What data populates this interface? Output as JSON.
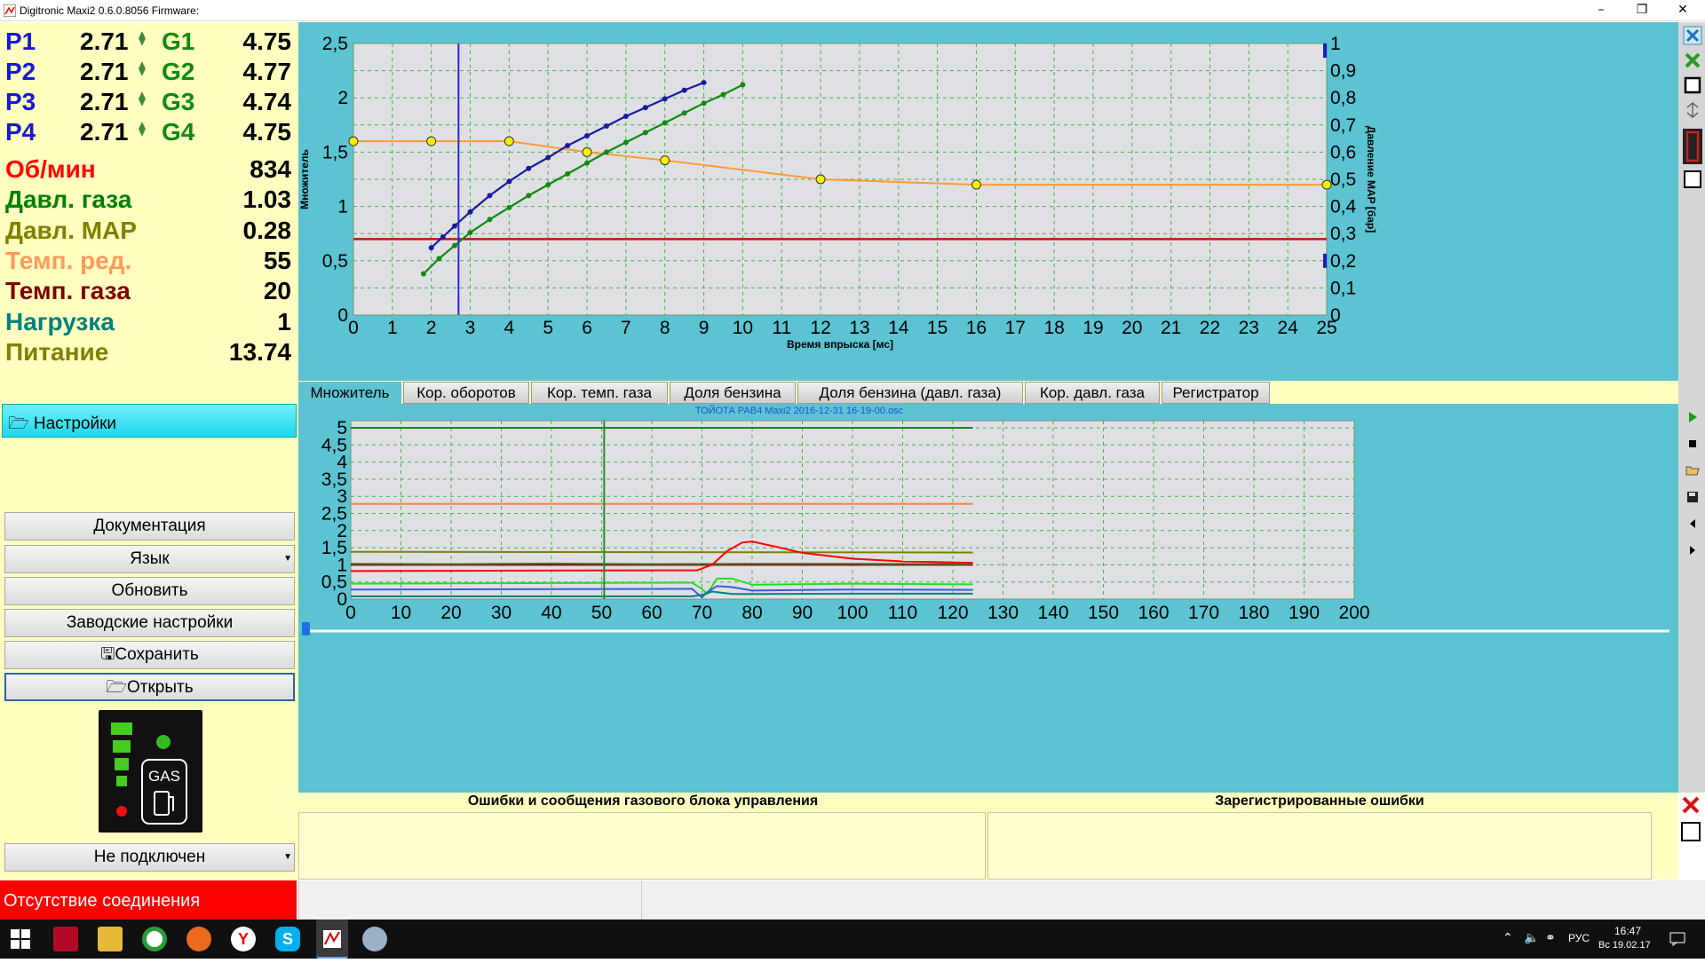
{
  "window": {
    "title": "Digitronic Maxi2 0.6.0.8056 Firmware:",
    "minimize": "–",
    "maximize": "❐",
    "close": "✕"
  },
  "injectors": [
    {
      "p_label": "P1",
      "p_value": "2.71",
      "g_label": "G1",
      "g_value": "4.75"
    },
    {
      "p_label": "P2",
      "p_value": "2.71",
      "g_label": "G2",
      "g_value": "4.77"
    },
    {
      "p_label": "P3",
      "p_value": "2.71",
      "g_label": "G3",
      "g_value": "4.74"
    },
    {
      "p_label": "P4",
      "p_value": "2.71",
      "g_label": "G4",
      "g_value": "4.75"
    }
  ],
  "params": [
    {
      "label": "Об/мин",
      "value": "834",
      "color": "#ff0000"
    },
    {
      "label": "Давл. газа",
      "value": "1.03",
      "color": "#008000"
    },
    {
      "label": "Давл. MAP",
      "value": "0.28",
      "color": "#808000"
    },
    {
      "label": "Темп. ред.",
      "value": "55",
      "color": "#ff9a5a"
    },
    {
      "label": "Темп. газа",
      "value": "20",
      "color": "#800000"
    },
    {
      "label": "Нагрузка",
      "value": "1",
      "color": "#008080"
    },
    {
      "label": "Питание",
      "value": "13.74",
      "color": "#808000"
    }
  ],
  "settings_label": "Настройки",
  "buttons": {
    "docs": "Документация",
    "language": "Язык",
    "update": "Обновить",
    "factory": "Заводские настройки",
    "save": "Сохранить",
    "open": "Открыть",
    "connection": "Не подключен"
  },
  "gas_indicator": {
    "label": "GAS"
  },
  "status": {
    "connection": "Отсутствие соединения"
  },
  "tabs": [
    "Множитель",
    "Кор. оборотов",
    "Кор. темп. газа",
    "Доля бензина",
    "Доля бензина (давл. газа)",
    "Кор. давл. газа",
    "Регистратор"
  ],
  "top_chart": {
    "ylabel": "Множитель",
    "y2label": "Давление MAP [бар]",
    "xlabel": "Время впрыска [мс]",
    "xlim": [
      0,
      25
    ],
    "ylim": [
      0,
      2.5
    ],
    "y2lim": [
      0,
      1
    ],
    "x_ticks": [
      "0",
      "1",
      "2",
      "3",
      "4",
      "5",
      "6",
      "7",
      "8",
      "9",
      "10",
      "11",
      "12",
      "13",
      "14",
      "15",
      "16",
      "17",
      "18",
      "19",
      "20",
      "21",
      "22",
      "23",
      "24",
      "25"
    ],
    "y_ticks": [
      "0",
      "0,5",
      "1",
      "1,5",
      "2",
      "2,5"
    ],
    "y2_ticks": [
      "0",
      "0,1",
      "0,2",
      "0,3",
      "0,4",
      "0,5",
      "0,6",
      "0,7",
      "0,8",
      "0,9",
      "1"
    ],
    "cursor_x": 2.7,
    "red_line_y": 0.7
  },
  "bottom_chart": {
    "title": "ТОЙОТА РАВ4 Maxi2 2016-12-31 16-19-00.osc",
    "xlim": [
      0,
      200
    ],
    "ylim": [
      0,
      5
    ],
    "x_ticks": [
      "0",
      "10",
      "20",
      "30",
      "40",
      "50",
      "60",
      "70",
      "80",
      "90",
      "100",
      "110",
      "120",
      "130",
      "140",
      "150",
      "160",
      "170",
      "180",
      "190",
      "200"
    ],
    "y_ticks": [
      "0",
      "0,5",
      "1",
      "1,5",
      "2",
      "2,5",
      "3",
      "3,5",
      "4",
      "4,5",
      "5"
    ],
    "cursor_x": 50.5
  },
  "chart_data": [
    {
      "type": "scatter",
      "title": "",
      "xlabel": "Время впрыска [мс]",
      "ylabel": "Множитель",
      "xlim": [
        0,
        25
      ],
      "ylim": [
        0,
        2.5
      ],
      "series": [
        {
          "color": "#1a1aa0",
          "x": [
            2.0,
            2.3,
            2.6,
            3.0,
            3.5,
            4.0,
            4.5,
            5.0,
            5.5,
            6.0,
            6.5,
            7.0,
            7.5,
            8.0,
            8.5,
            9.0
          ],
          "y": [
            0.62,
            0.72,
            0.82,
            0.95,
            1.1,
            1.23,
            1.35,
            1.45,
            1.56,
            1.65,
            1.74,
            1.83,
            1.91,
            1.99,
            2.07,
            2.14
          ]
        },
        {
          "color": "#108a10",
          "x": [
            1.8,
            2.2,
            2.6,
            3.0,
            3.5,
            4.0,
            4.5,
            5.0,
            5.5,
            6.0,
            6.5,
            7.0,
            7.5,
            8.0,
            8.5,
            9.0,
            9.5,
            10.0
          ],
          "y": [
            0.38,
            0.52,
            0.64,
            0.76,
            0.88,
            0.99,
            1.1,
            1.2,
            1.3,
            1.4,
            1.5,
            1.59,
            1.68,
            1.77,
            1.86,
            1.95,
            2.03,
            2.12
          ]
        },
        {
          "color": "#ff9a30",
          "x": [
            0,
            2,
            4,
            6,
            8,
            12,
            16,
            25
          ],
          "y2": [
            0.64,
            0.64,
            0.64,
            0.6,
            0.57,
            0.5,
            0.48,
            0.48
          ]
        }
      ]
    },
    {
      "type": "line",
      "title": "ТОЙОТА РАВ4 Maxi2 2016-12-31 16-19-00.osc",
      "xlim": [
        0,
        200
      ],
      "ylim": [
        0,
        5
      ],
      "series": [
        {
          "color": "#108a10",
          "x": [
            0,
            124
          ],
          "y": [
            5,
            5
          ]
        },
        {
          "color": "#ff8040",
          "x": [
            0,
            124
          ],
          "y": [
            2.78,
            2.78
          ]
        },
        {
          "color": "#808000",
          "x": [
            0,
            124
          ],
          "y": [
            1.38,
            1.36
          ]
        },
        {
          "color": "#800000",
          "x": [
            0,
            124
          ],
          "y": [
            1.0,
            1.0
          ]
        },
        {
          "color": "#556b2f",
          "x": [
            0,
            20,
            40,
            60,
            80,
            100,
            124
          ],
          "y": [
            1.03,
            1.02,
            1.04,
            1.02,
            1.03,
            1.03,
            1.02
          ]
        },
        {
          "color": "#ff0000",
          "x": [
            0,
            60,
            69,
            72,
            75,
            78,
            80,
            85,
            90,
            100,
            110,
            124
          ],
          "y": [
            0.82,
            0.84,
            0.84,
            1.0,
            1.4,
            1.65,
            1.68,
            1.52,
            1.35,
            1.18,
            1.1,
            1.06
          ]
        },
        {
          "color": "#22dd22",
          "x": [
            0,
            68,
            70,
            71,
            73,
            76,
            80,
            100,
            124
          ],
          "y": [
            0.45,
            0.48,
            0.3,
            0.15,
            0.6,
            0.6,
            0.42,
            0.45,
            0.43
          ]
        },
        {
          "color": "#3a5ad8",
          "x": [
            0,
            68,
            70,
            71,
            73,
            76,
            80,
            100,
            124
          ],
          "y": [
            0.28,
            0.3,
            0.05,
            0.2,
            0.38,
            0.35,
            0.25,
            0.28,
            0.27
          ]
        },
        {
          "color": "#008080",
          "x": [
            0,
            68,
            70,
            72,
            76,
            80,
            100,
            124
          ],
          "y": [
            0.08,
            0.08,
            0.12,
            0.22,
            0.15,
            0.15,
            0.16,
            0.16
          ]
        }
      ]
    }
  ],
  "errors": {
    "left_title": "Ошибки и сообщения газового блока управления",
    "right_title": "Зарегистрированные ошибки"
  },
  "taskbar": {
    "lang": "РУС",
    "time": "16:47",
    "date": "Вс 19.02.17"
  }
}
